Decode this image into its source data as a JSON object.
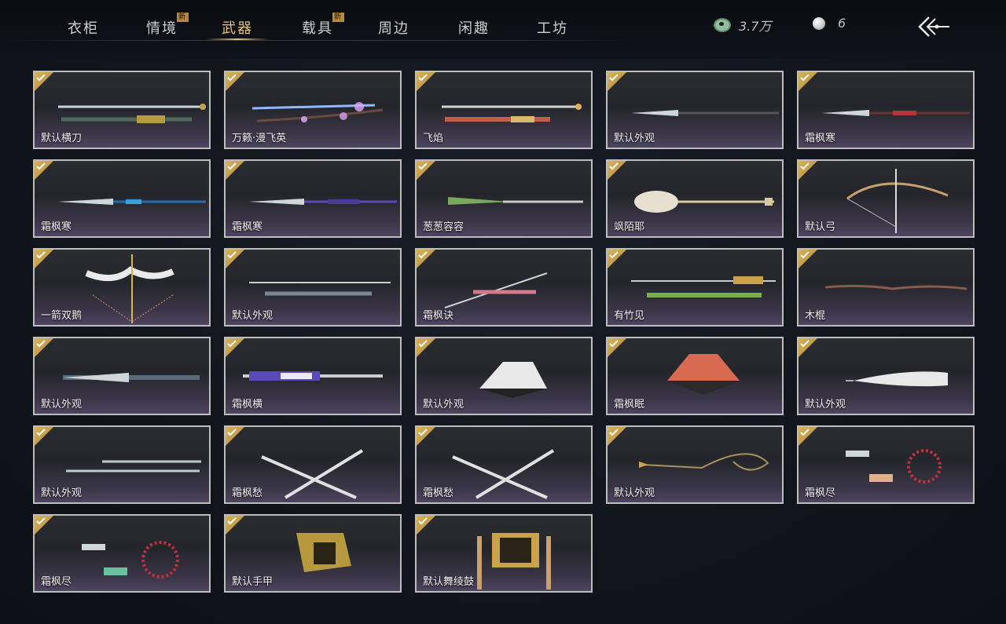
{
  "tabs": [
    {
      "label": "衣柜",
      "badge": ""
    },
    {
      "label": "情境",
      "badge": "新"
    },
    {
      "label": "武器",
      "badge": ""
    },
    {
      "label": "载具",
      "badge": "新"
    },
    {
      "label": "周边",
      "badge": ""
    },
    {
      "label": "闲趣",
      "badge": ""
    },
    {
      "label": "工坊",
      "badge": ""
    }
  ],
  "active_tab": "武器",
  "currency": {
    "jade_amount": "3.7万",
    "pearl_amount": "6"
  },
  "accent_color": "#e8c37a",
  "items": [
    {
      "name": "默认横刀",
      "owned": true,
      "icon": "saber-with-scabbard"
    },
    {
      "name": "万籁·漫飞英",
      "owned": true,
      "icon": "flower-sword"
    },
    {
      "name": "飞焰",
      "owned": true,
      "icon": "ornate-sword-with-scabbard"
    },
    {
      "name": "默认外观",
      "owned": true,
      "icon": "glaive"
    },
    {
      "name": "霜枫寒",
      "owned": true,
      "icon": "red-glaive"
    },
    {
      "name": "霜枫寒",
      "owned": true,
      "icon": "blue-glaive"
    },
    {
      "name": "霜枫寒",
      "owned": true,
      "icon": "purple-glaive"
    },
    {
      "name": "葱葱容容",
      "owned": true,
      "icon": "scallion-spear"
    },
    {
      "name": "飒陌耶",
      "owned": true,
      "icon": "spoon-staff"
    },
    {
      "name": "默认弓",
      "owned": true,
      "icon": "bow"
    },
    {
      "name": "一箭双鹅",
      "owned": true,
      "icon": "goose-bow"
    },
    {
      "name": "默认外观",
      "owned": true,
      "icon": "sword-pair"
    },
    {
      "name": "霜枫诀",
      "owned": true,
      "icon": "katana"
    },
    {
      "name": "有竹见",
      "owned": true,
      "icon": "bamboo-sword"
    },
    {
      "name": "木棍",
      "owned": true,
      "icon": "wooden-stick"
    },
    {
      "name": "默认外观",
      "owned": true,
      "icon": "dual-blade"
    },
    {
      "name": "霜枫横",
      "owned": true,
      "icon": "ornate-dual-blade"
    },
    {
      "name": "默认外观",
      "owned": true,
      "icon": "folding-fan"
    },
    {
      "name": "霜枫眠",
      "owned": true,
      "icon": "red-fan"
    },
    {
      "name": "默认外观",
      "owned": true,
      "icon": "striped-fan"
    },
    {
      "name": "默认外观",
      "owned": true,
      "icon": "twin-swords"
    },
    {
      "name": "霜枫愁",
      "owned": true,
      "icon": "crossed-swords"
    },
    {
      "name": "霜枫愁",
      "owned": true,
      "icon": "crossed-swords"
    },
    {
      "name": "默认外观",
      "owned": true,
      "icon": "rope-dart"
    },
    {
      "name": "霜枫尽",
      "owned": true,
      "icon": "beaded-dart"
    },
    {
      "name": "霜枫尽",
      "owned": true,
      "icon": "jade-beaded-dart"
    },
    {
      "name": "默认手甲",
      "owned": true,
      "icon": "gauntlet"
    },
    {
      "name": "默认舞绫鼓",
      "owned": true,
      "icon": "drum"
    }
  ]
}
